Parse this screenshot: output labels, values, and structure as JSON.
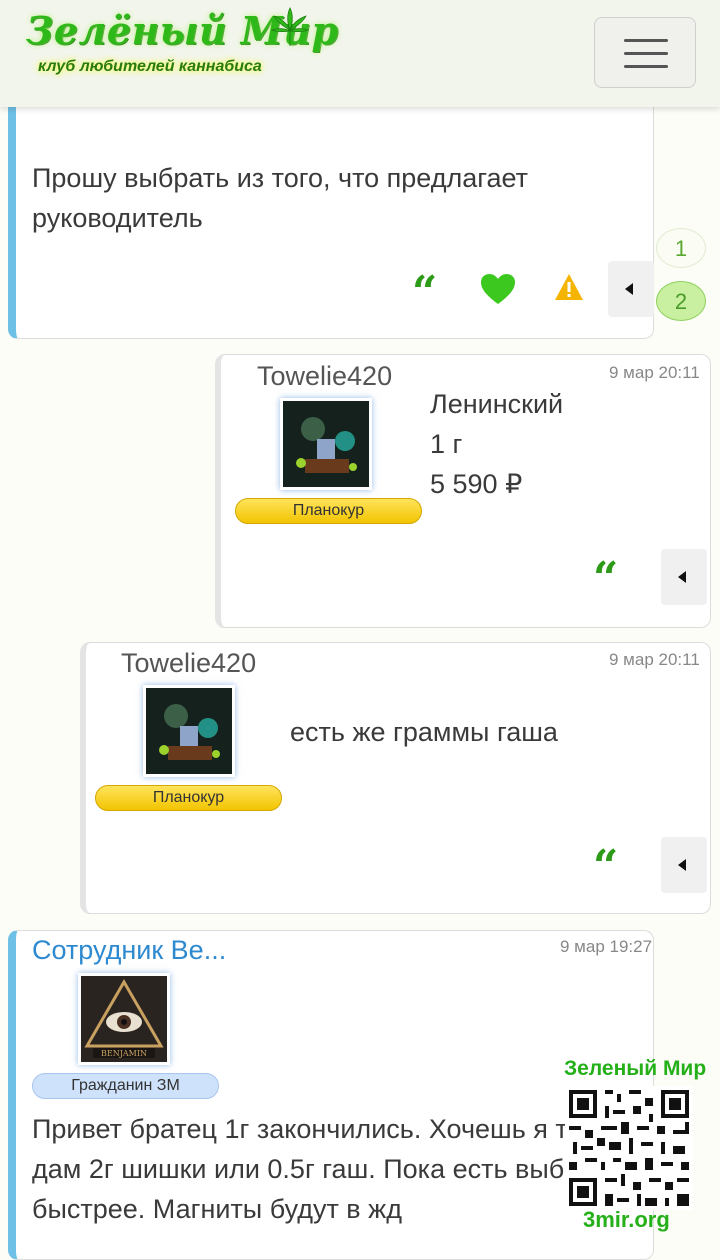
{
  "header": {
    "logo_title": "Зелёный Мир",
    "logo_subtitle": "клуб любителей каннабиса",
    "menu_icon": "hamburger-icon"
  },
  "pagination": {
    "pages": [
      "1",
      "2"
    ],
    "active": "2"
  },
  "posts": [
    {
      "text_lines": [
        "Прошу выбрать из того, что предлагает",
        "руководитель"
      ],
      "actions": [
        "quote-icon",
        "heart-icon",
        "warning-icon",
        "back-icon"
      ]
    },
    {
      "author": "Towelie420",
      "time": "9 мар 20:11",
      "rank": "Планокур",
      "text_lines": [
        "Ленинский",
        "1 г",
        "5 590 ₽"
      ],
      "actions": [
        "quote-icon",
        "back-icon"
      ]
    },
    {
      "author": "Towelie420",
      "time": "9 мар 20:11",
      "rank": "Планокур",
      "text_lines": [
        "есть же граммы гаша"
      ],
      "actions": [
        "quote-icon",
        "back-icon"
      ]
    },
    {
      "author": "Сотрудник Be...",
      "time": "9 мар 19:27",
      "rank": "Гражданин ЗМ",
      "avatar_label": "BENJAMIN",
      "text_lines": [
        "Привет братец 1г закончились. Хочешь я те",
        "дам 2г шишки или 0.5г гаш. Пока есть выбо",
        "быстрее. Магниты будут в жд"
      ]
    }
  ],
  "qr": {
    "title": "Зеленый Мир",
    "url": "3mir.org"
  },
  "colors": {
    "accent_green": "#2d9a18",
    "heart": "#3cc81e",
    "warning": "#f5b400",
    "author_blue": "#2d8ad0",
    "rank_gold": "#f2c400",
    "rank_blue": "#cfe2fb"
  }
}
